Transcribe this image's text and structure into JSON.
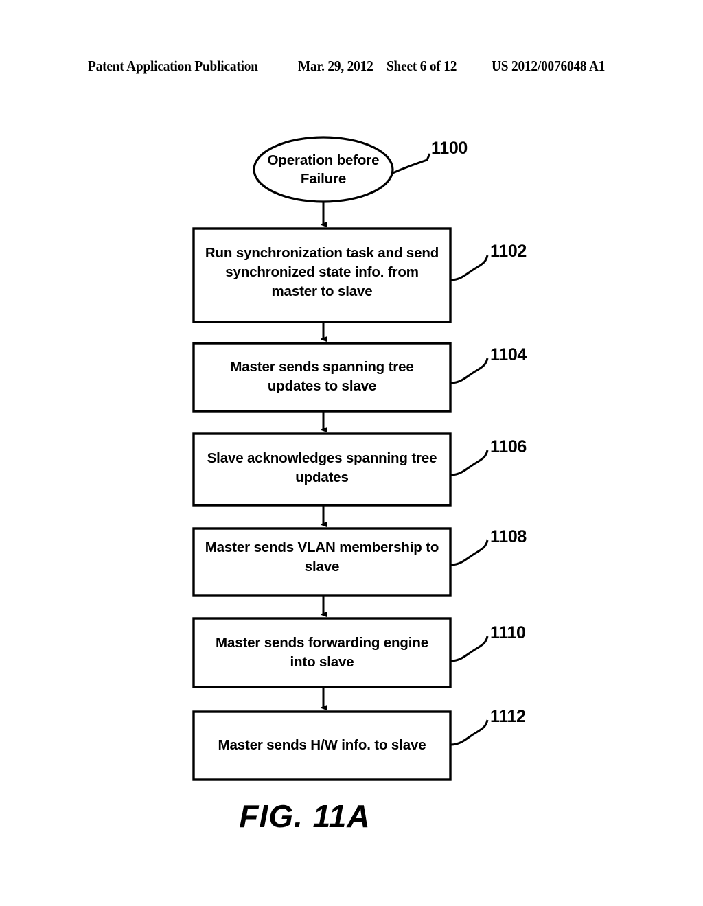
{
  "header": {
    "publication": "Patent Application Publication",
    "date": "Mar. 29, 2012",
    "sheet": "Sheet 6 of 12",
    "patent_number": "US 2012/0076048 A1"
  },
  "figure": {
    "caption": "FIG. 11A",
    "terminator": {
      "ref": "1100",
      "line1": "Operation before",
      "line2": "Failure"
    },
    "steps": [
      {
        "ref": "1102",
        "line1": "Run synchronization task and send",
        "line2": "synchronized state info. from",
        "line3": "master to slave"
      },
      {
        "ref": "1104",
        "line1": "Master sends spanning tree",
        "line2": "updates to slave",
        "line3": ""
      },
      {
        "ref": "1106",
        "line1": "Slave acknowledges spanning tree",
        "line2": "updates",
        "line3": ""
      },
      {
        "ref": "1108",
        "line1": "Master sends VLAN membership to",
        "line2": "slave",
        "line3": ""
      },
      {
        "ref": "1110",
        "line1": "Master sends forwarding engine",
        "line2": "into slave",
        "line3": ""
      },
      {
        "ref": "1112",
        "line1": "Master sends H/W info. to slave",
        "line2": "",
        "line3": ""
      }
    ]
  },
  "colors": {
    "ink": "#000000",
    "paper": "#ffffff"
  }
}
